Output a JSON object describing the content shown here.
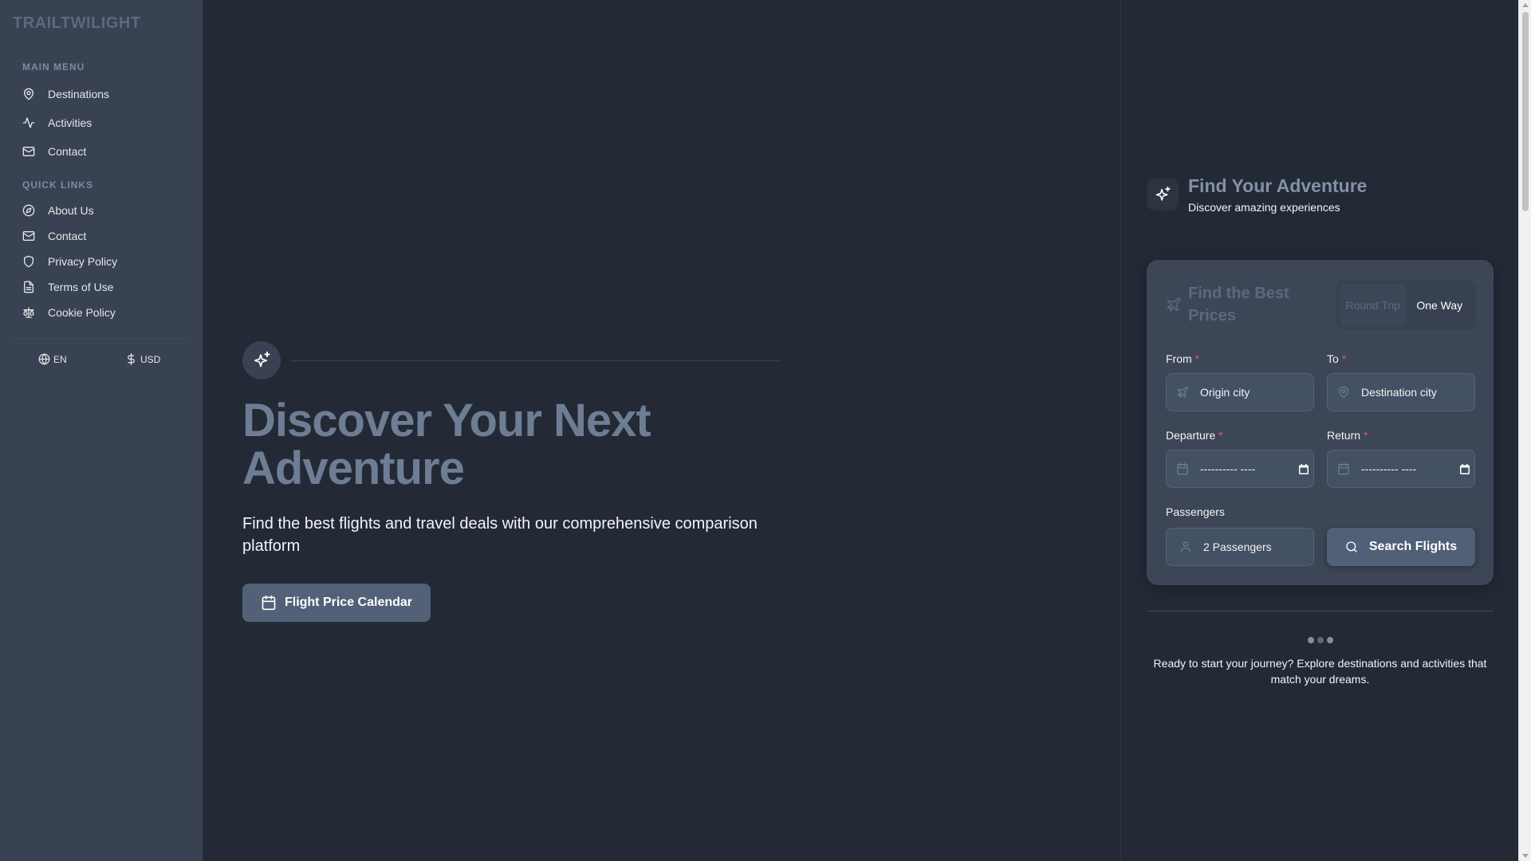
{
  "brand": "TRAILTWILIGHT",
  "sidebar": {
    "main_menu_label": "MAIN MENU",
    "main_items": [
      {
        "label": "Destinations",
        "icon": "map-pin-icon"
      },
      {
        "label": "Activities",
        "icon": "activity-icon"
      },
      {
        "label": "Contact",
        "icon": "mail-icon"
      }
    ],
    "quick_links_label": "QUICK LINKS",
    "quick_items": [
      {
        "label": "About Us",
        "icon": "compass-icon"
      },
      {
        "label": "Contact",
        "icon": "mail-icon"
      },
      {
        "label": "Privacy Policy",
        "icon": "shield-icon"
      },
      {
        "label": "Terms of Use",
        "icon": "file-text-icon"
      },
      {
        "label": "Cookie Policy",
        "icon": "scale-icon"
      }
    ],
    "language": "EN",
    "currency": "USD"
  },
  "hero": {
    "title": "Discover Your Next Adventure",
    "subtitle": "Find the best flights and travel deals with our comprehensive comparison platform",
    "calendar_button": "Flight Price Calendar"
  },
  "panel": {
    "title": "Find Your Adventure",
    "subtitle": "Discover amazing experiences",
    "card": {
      "title": "Find the Best Prices",
      "trip_types": [
        "Round Trip",
        "One Way"
      ],
      "selected_trip_type": "One Way",
      "from_label": "From",
      "from_placeholder": "Origin city",
      "to_label": "To",
      "to_placeholder": "Destination city",
      "departure_label": "Departure",
      "departure_value": "---------- ----",
      "return_label": "Return",
      "return_value": "---------- ----",
      "passengers_label": "Passengers",
      "passengers_value": "2 Passengers",
      "search_button": "Search Flights",
      "required_mark": "*"
    },
    "journey_text": "Ready to start your journey? Explore destinations and activities that match your dreams."
  },
  "colors": {
    "background": "#232a36",
    "sidebar": "#384252",
    "card": "#3d4656",
    "accent": "#516077",
    "required": "#e25a5a"
  }
}
